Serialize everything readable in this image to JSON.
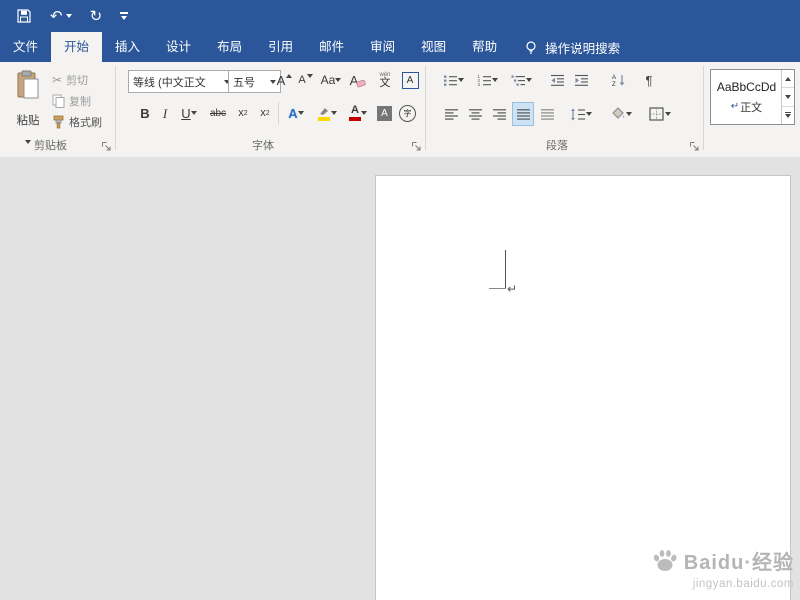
{
  "colors": {
    "accent": "#2b579a",
    "ribbon_bg": "#f4f3f1",
    "doc_bg": "#e2e2e2",
    "highlight_yellow": "#ffd800",
    "font_color_red": "#c00000"
  },
  "icons": {
    "undo": "↶",
    "redo": "↻",
    "scissors": "✂",
    "pilcrow": "¶"
  },
  "tabs": {
    "file": "文件",
    "active": "开始",
    "items": [
      "开始",
      "插入",
      "设计",
      "布局",
      "引用",
      "邮件",
      "审阅",
      "视图",
      "帮助"
    ],
    "search": "操作说明搜索"
  },
  "ribbon": {
    "clipboard": {
      "label": "剪贴板",
      "paste": "粘贴",
      "cut": "剪切",
      "copy": "复制",
      "painter": "格式刷"
    },
    "font": {
      "label": "字体",
      "name_value": "等线 (中文正文",
      "size_value": "五号",
      "grow": "A",
      "shrink": "A",
      "change_case": "Aa",
      "clear_format": "A",
      "pinyin_ruby": "wén",
      "pinyin_char": "文",
      "border_char": "A",
      "bold": "B",
      "italic": "I",
      "underline": "U",
      "strike": "abc",
      "sub_base": "x",
      "sub_small": "2",
      "sup_base": "x",
      "sup_small": "2",
      "effects": "A",
      "fontcolor": "A",
      "char_shading": "A",
      "enclose": "字"
    },
    "paragraph": {
      "label": "段落",
      "sort_a": "A",
      "sort_z": "Z",
      "num_digits": [
        "1",
        "2",
        "3"
      ]
    },
    "styles": {
      "preview": "AaBbCcDd",
      "mark": "↵",
      "name": "正文"
    }
  },
  "document": {
    "paragraph_mark": "↵"
  },
  "watermark": {
    "brand": "Baidu·经验",
    "url": "jingyan.baidu.com"
  }
}
